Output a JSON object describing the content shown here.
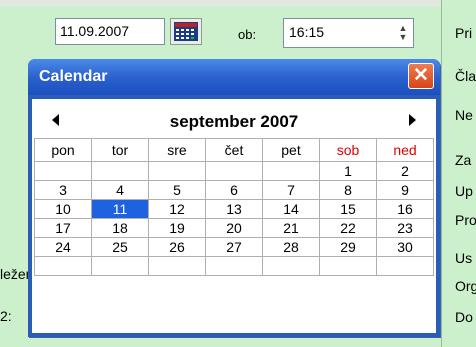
{
  "form": {
    "date_value": "11.09.2007",
    "ob_label": "ob:",
    "time_value": "16:15",
    "right_labels": [
      "Pri",
      "Čla",
      "Ne",
      "Za",
      "Up",
      "Pro",
      "Us",
      "Org",
      "Do"
    ],
    "left_label_fragment": "ležencı",
    "left_label_fragment2": "2:"
  },
  "calendar_window": {
    "title": "Calendar",
    "close_symbol": "✕",
    "month_label": "september 2007",
    "prev_symbol": "◀",
    "next_symbol": "▶",
    "weekdays": [
      "pon",
      "tor",
      "sre",
      "čet",
      "pet",
      "sob",
      "ned"
    ],
    "weekend_color": "#e00000",
    "selected_color": "#1f62e0",
    "weeks": [
      [
        "",
        "",
        "",
        "",
        "",
        "1",
        "2"
      ],
      [
        "3",
        "4",
        "5",
        "6",
        "7",
        "8",
        "9"
      ],
      [
        "10",
        "11",
        "12",
        "13",
        "14",
        "15",
        "16"
      ],
      [
        "17",
        "18",
        "19",
        "20",
        "21",
        "22",
        "23"
      ],
      [
        "24",
        "25",
        "26",
        "27",
        "28",
        "29",
        "30"
      ],
      [
        "",
        "",
        "",
        "",
        "",
        "",
        ""
      ]
    ],
    "selected_day": "11"
  }
}
